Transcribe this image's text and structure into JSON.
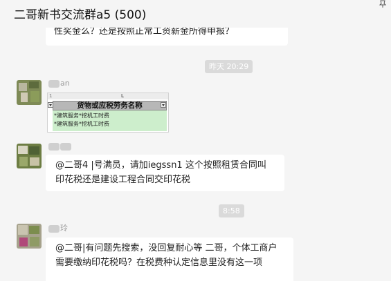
{
  "window": {
    "title": "二哥新书交流群a5 (500)",
    "pin_icon": "pin-icon"
  },
  "messages": [
    {
      "text": "性奖金么？还是按照正常工资薪金所得申报？"
    },
    {
      "sender": "an",
      "attachment": {
        "column_letter": "L",
        "row_number": "1",
        "header": "货物或应税劳务名称",
        "rows": [
          "*建筑服务*挖机工时费",
          "*建筑服务*挖机工时费"
        ]
      }
    },
    {
      "sender": "",
      "text": "@二哥4 |号满员，请加iegssn1 这个按照租赁合同叫印花税还是建设工程合同交印花税"
    },
    {
      "sender": "玲",
      "text": "@二哥|有问题先搜索，没回复耐心等   二哥，个体工商户需要缴纳印花税吗？在税费种认定信息里没有这一项"
    }
  ],
  "timestamps": [
    "昨天 20:29",
    "8:58"
  ],
  "colors": {
    "background": "#f5f5f5",
    "bubble": "#ffffff",
    "timestamp_bg": "#dadada",
    "sheet_header": "#b7b7b7",
    "sheet_rows": "#cdeecc"
  }
}
